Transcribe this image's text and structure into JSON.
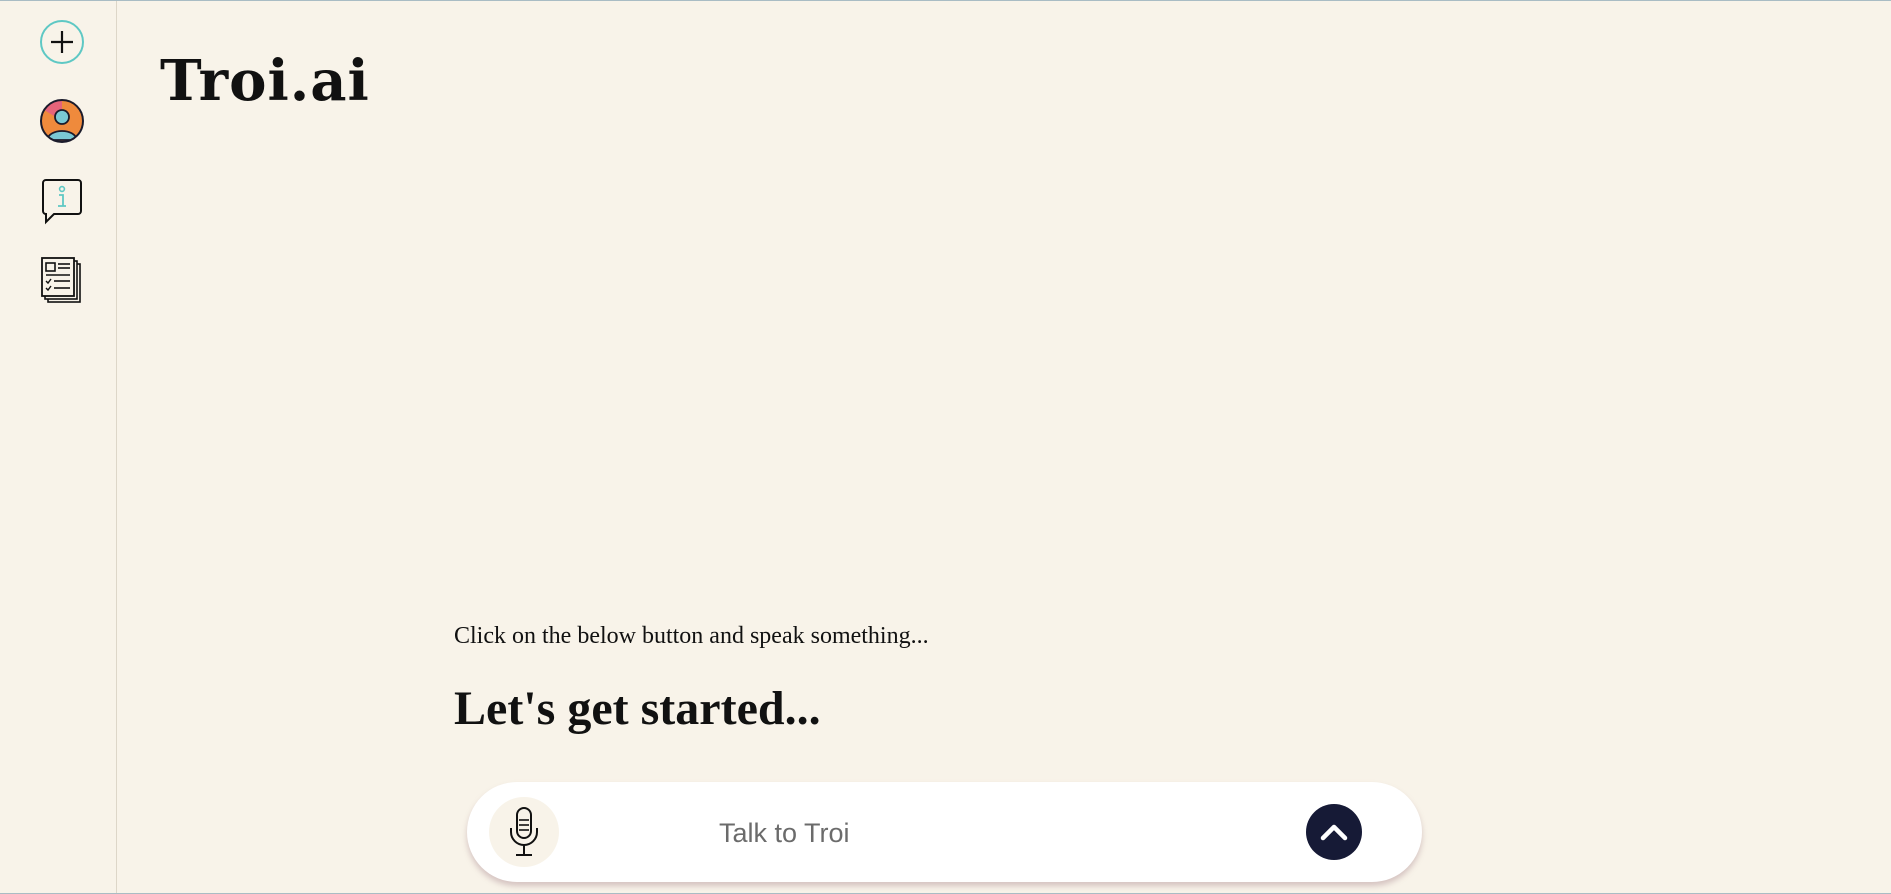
{
  "app": {
    "brand": "Troi.ai"
  },
  "sidebar": {
    "items": [
      {
        "icon": "plus-circle-icon"
      },
      {
        "icon": "user-avatar-icon"
      },
      {
        "icon": "info-chat-icon"
      },
      {
        "icon": "news-checklist-icon"
      }
    ]
  },
  "main": {
    "hint": "Click on the below button and speak something...",
    "headline": "Let's get started..."
  },
  "input_bar": {
    "placeholder": "Talk to Troi",
    "mic_icon": "microphone-icon",
    "send_icon": "chevron-up-icon"
  },
  "colors": {
    "background": "#f8f3e9",
    "accent_teal": "#5ec8c4",
    "send_button": "#161a36",
    "avatar_orange": "#ef8a3c",
    "avatar_teal": "#7ac9d4"
  }
}
